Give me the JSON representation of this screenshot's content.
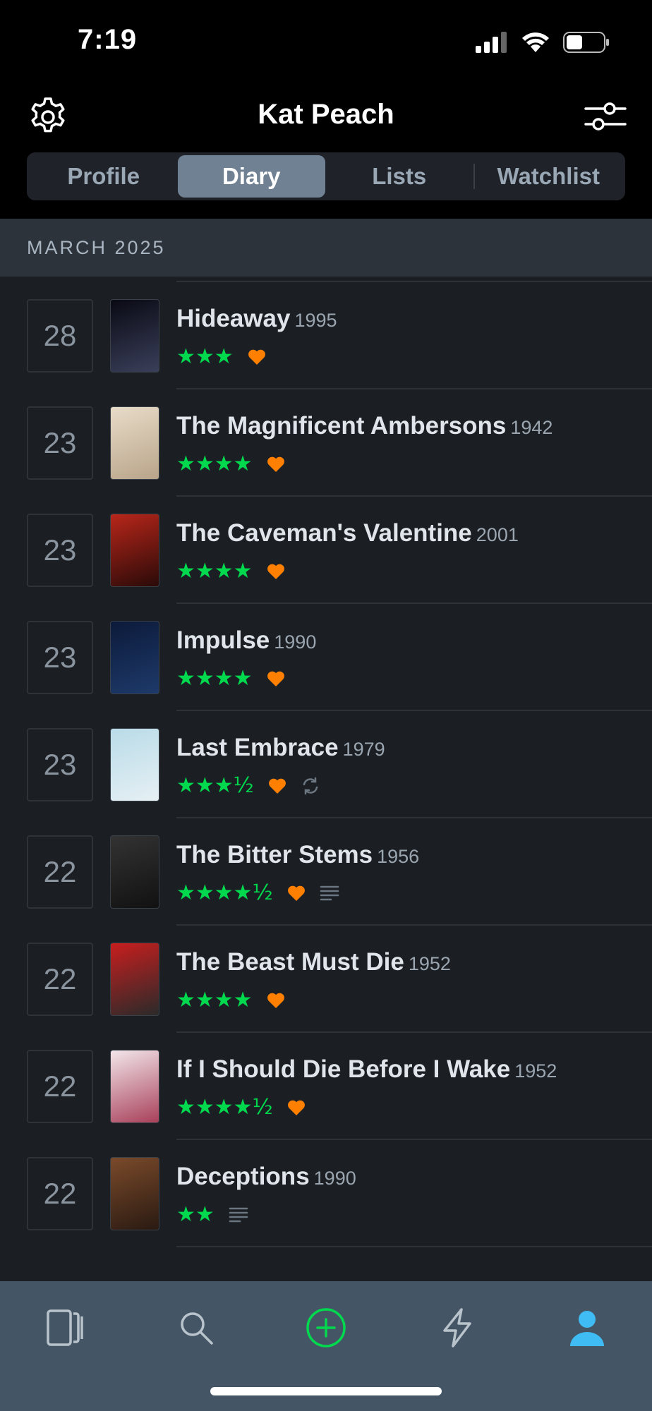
{
  "status": {
    "time": "7:19"
  },
  "header": {
    "title": "Kat Peach"
  },
  "tabs": [
    {
      "label": "Profile",
      "active": false
    },
    {
      "label": "Diary",
      "active": true
    },
    {
      "label": "Lists",
      "active": false
    },
    {
      "label": "Watchlist",
      "active": false
    }
  ],
  "section": {
    "label": "MARCH 2025"
  },
  "entries": [
    {
      "day": "28",
      "title": "Hideaway",
      "year": "1995",
      "stars": "★★★",
      "liked": true,
      "rewatch": false,
      "review": false,
      "poster_colors": [
        "#0a0a14",
        "#3a3f5a"
      ]
    },
    {
      "day": "23",
      "title": "The Magnificent Ambersons",
      "year": "1942",
      "stars": "★★★★",
      "liked": true,
      "rewatch": false,
      "review": false,
      "poster_colors": [
        "#e8dcc8",
        "#b9a48a"
      ]
    },
    {
      "day": "23",
      "title": "The Caveman's Valentine",
      "year": "2001",
      "stars": "★★★★",
      "liked": true,
      "rewatch": false,
      "review": false,
      "poster_colors": [
        "#b8261a",
        "#2a0a08"
      ]
    },
    {
      "day": "23",
      "title": "Impulse",
      "year": "1990",
      "stars": "★★★★",
      "liked": true,
      "rewatch": false,
      "review": false,
      "poster_colors": [
        "#0c1a3a",
        "#1e3a6a"
      ]
    },
    {
      "day": "23",
      "title": "Last Embrace",
      "year": "1979",
      "stars": "★★★½",
      "liked": true,
      "rewatch": true,
      "review": false,
      "poster_colors": [
        "#b9dbe8",
        "#e6f0f4"
      ]
    },
    {
      "day": "22",
      "title": "The Bitter Stems",
      "year": "1956",
      "stars": "★★★★½",
      "liked": true,
      "rewatch": false,
      "review": true,
      "poster_colors": [
        "#333333",
        "#111111"
      ]
    },
    {
      "day": "22",
      "title": "The Beast Must Die",
      "year": "1952",
      "stars": "★★★★",
      "liked": true,
      "rewatch": false,
      "review": false,
      "poster_colors": [
        "#c81e1e",
        "#2a2a2a"
      ]
    },
    {
      "day": "22",
      "title": "If I Should Die Before I Wake",
      "year": "1952",
      "stars": "★★★★½",
      "liked": true,
      "rewatch": false,
      "review": false,
      "poster_colors": [
        "#f2e6ea",
        "#a8405a"
      ]
    },
    {
      "day": "22",
      "title": "Deceptions",
      "year": "1990",
      "stars": "★★",
      "liked": false,
      "rewatch": false,
      "review": true,
      "poster_colors": [
        "#7a4a2a",
        "#2a1a12"
      ]
    }
  ],
  "colors": {
    "star": "#00d94d",
    "heart": "#ff8000",
    "active_tab": "#6f8193",
    "tabbar": "#445566",
    "accent_profile": "#40bcf4",
    "add_button": "#00d94d"
  },
  "tabbar": [
    {
      "icon": "films-icon"
    },
    {
      "icon": "search-icon"
    },
    {
      "icon": "add-icon"
    },
    {
      "icon": "activity-icon"
    },
    {
      "icon": "profile-icon",
      "active": true
    }
  ]
}
